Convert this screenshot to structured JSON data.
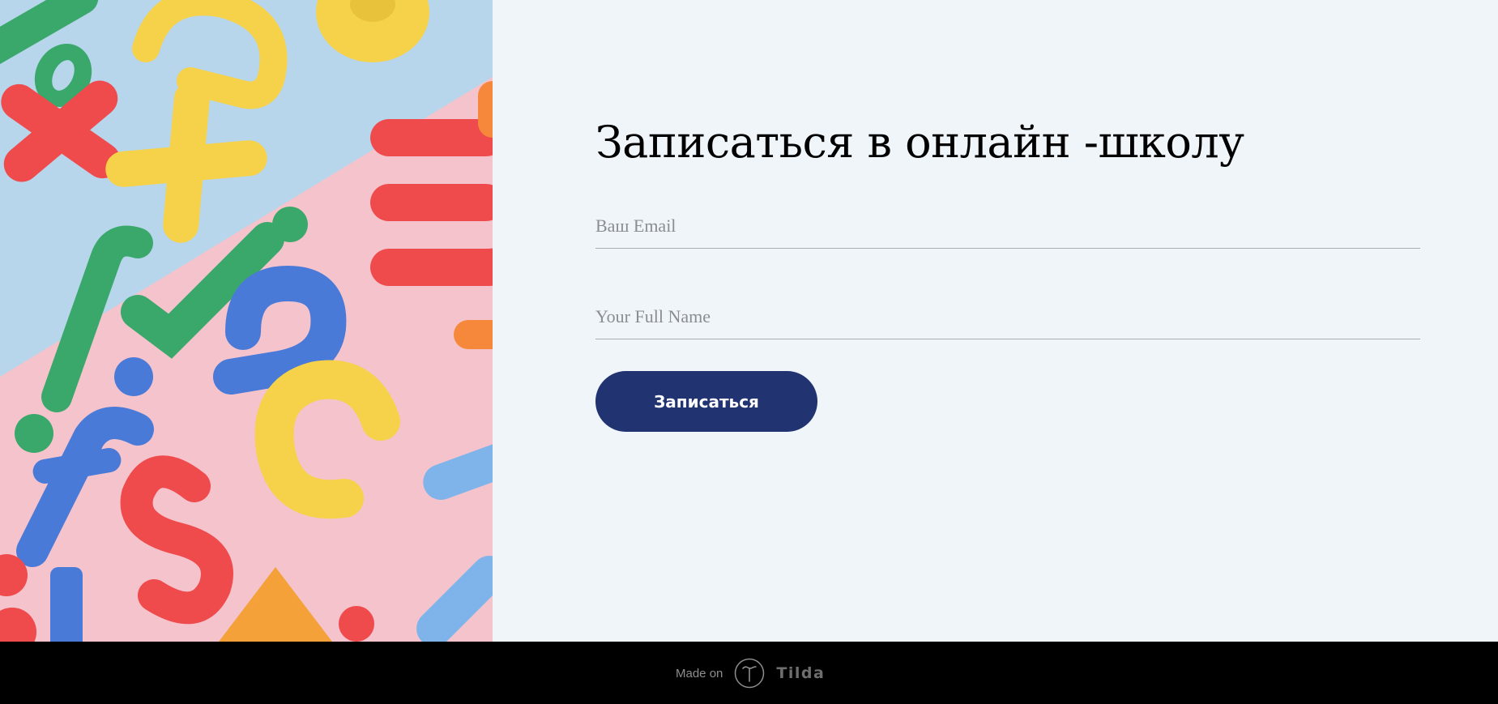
{
  "form": {
    "title": "Записаться в онлайн -школу",
    "email_placeholder": "Ваш Email",
    "name_placeholder": "Your Full Name",
    "submit_label": "Записаться"
  },
  "footer": {
    "made_on": "Made on",
    "brand": "Tilda"
  },
  "colors": {
    "background": "#f0f5fa",
    "button": "#213371",
    "footer": "#000000"
  }
}
